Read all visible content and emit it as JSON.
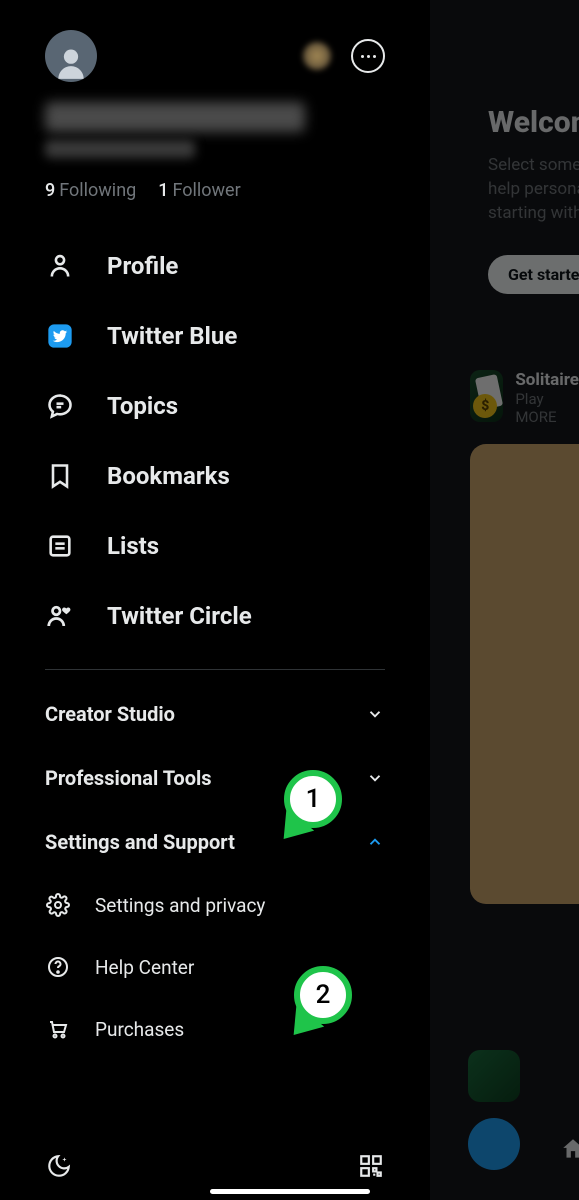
{
  "header": {
    "following_count": "9",
    "following_label": "Following",
    "followers_count": "1",
    "followers_label": "Follower"
  },
  "nav": {
    "profile": "Profile",
    "twitter_blue": "Twitter Blue",
    "topics": "Topics",
    "bookmarks": "Bookmarks",
    "lists": "Lists",
    "twitter_circle": "Twitter Circle"
  },
  "sections": {
    "creator_studio": "Creator Studio",
    "professional_tools": "Professional Tools",
    "settings_support": "Settings and Support"
  },
  "sub": {
    "settings_privacy": "Settings and privacy",
    "help_center": "Help Center",
    "purchases": "Purchases"
  },
  "annotations": {
    "a1": "1",
    "a2": "2"
  },
  "backdrop": {
    "welcome": "Welcome",
    "sub1": "Select some topics",
    "sub2": "help personalize",
    "sub3": "starting with",
    "cta": "Get started",
    "card_title": "Solitaire",
    "card_line1": "Play",
    "card_line2": "MORE"
  }
}
